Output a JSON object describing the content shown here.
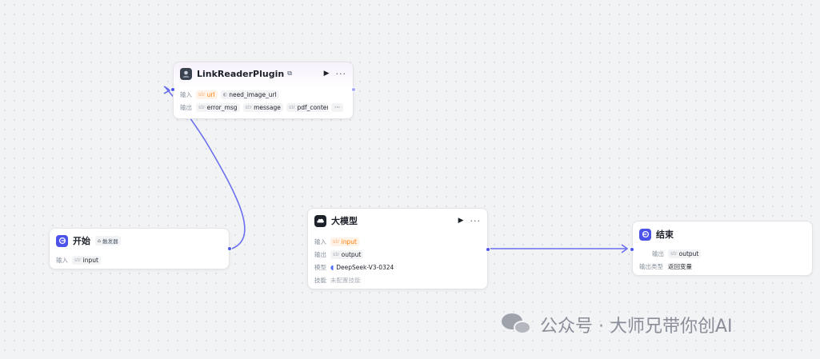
{
  "canvas": {
    "accent": "#4d53e8",
    "background": "#f2f3f5"
  },
  "nodes": {
    "linkreader": {
      "title": "LinkReaderPlugin",
      "icon": "plugin-avatar-icon",
      "inputs_label": "输入",
      "outputs_label": "输出",
      "inputs": [
        {
          "type": "str",
          "name": "url",
          "warning": true
        },
        {
          "type": "bool",
          "name": "need_image_url",
          "warning": false
        }
      ],
      "outputs": [
        {
          "type": "str",
          "name": "error_msg"
        },
        {
          "type": "str",
          "name": "message"
        },
        {
          "type": "str",
          "name": "pdf_content"
        }
      ],
      "more_outputs": "···"
    },
    "start": {
      "title": "开始",
      "badge": "触发器",
      "icon": "start-icon",
      "inputs_label": "输入",
      "inputs": [
        {
          "type": "str",
          "name": "input"
        }
      ]
    },
    "llm": {
      "title": "大模型",
      "icon": "llm-icon",
      "inputs_label": "输入",
      "outputs_label": "输出",
      "model_label": "模型",
      "skills_label": "技能",
      "inputs": [
        {
          "type": "str",
          "name": "input",
          "warning": true
        }
      ],
      "outputs": [
        {
          "type": "str",
          "name": "output"
        }
      ],
      "model": "DeepSeek-V3-0324",
      "skills": "未配置技能"
    },
    "end": {
      "title": "结束",
      "icon": "end-icon",
      "outputs_label": "输出",
      "output_type_label": "输出类型",
      "outputs": [
        {
          "type": "str",
          "name": "output"
        }
      ],
      "output_type": "返回变量"
    }
  },
  "watermark": "公众号 · 大师兄带你创AI"
}
